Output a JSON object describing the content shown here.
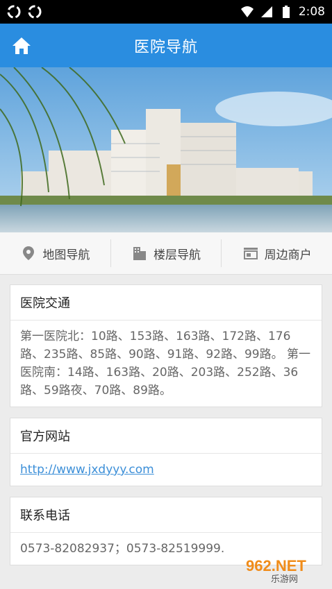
{
  "statusbar": {
    "time": "2:08"
  },
  "appbar": {
    "title": "医院导航"
  },
  "tabs": [
    {
      "label": "地图导航",
      "icon": "location-pin-icon"
    },
    {
      "label": "楼层导航",
      "icon": "building-icon"
    },
    {
      "label": "周边商户",
      "icon": "store-icon"
    }
  ],
  "sections": {
    "traffic": {
      "title": "医院交通",
      "body": "第一医院北：10路、153路、163路、172路、176路、235路、85路、90路、91路、92路、99路。 第一医院南：14路、163路、20路、203路、252路、36路、59路夜、70路、89路。"
    },
    "website": {
      "title": "官方网站",
      "url": "http://www.jxdyyy.com"
    },
    "phone": {
      "title": "联系电话",
      "body": "0573-82082937；0573-82519999."
    }
  },
  "watermark": {
    "text": "962.NET",
    "sub": "乐游网"
  },
  "colors": {
    "primary": "#2a8de0",
    "link": "#3c8fd8"
  }
}
